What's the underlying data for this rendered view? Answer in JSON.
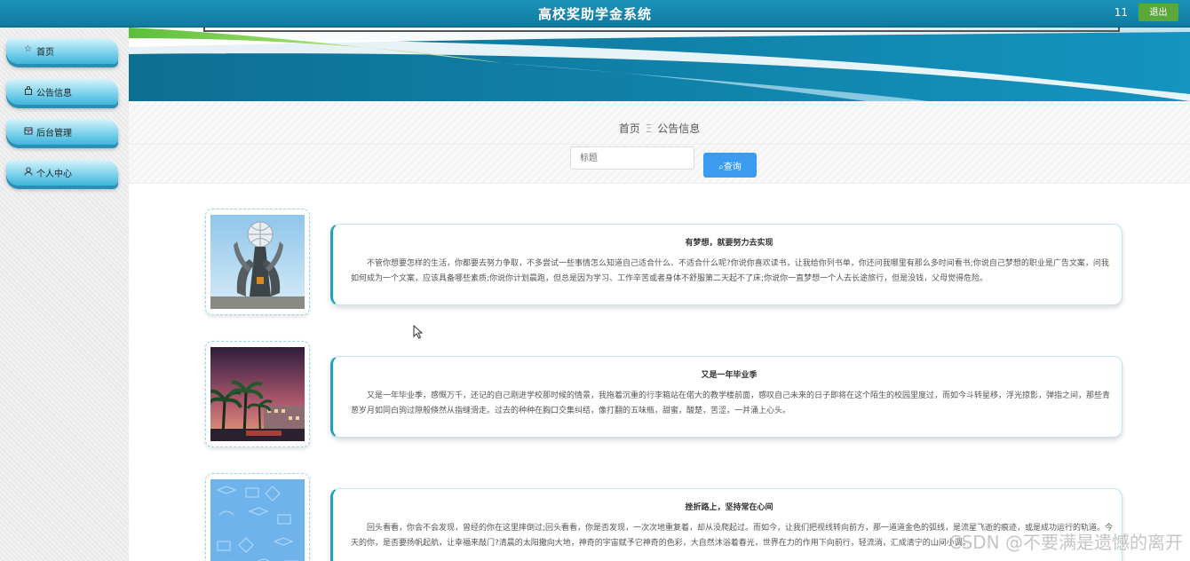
{
  "header": {
    "title": "高校奖助学金系统",
    "user": "11",
    "logout_label": "退出"
  },
  "sidebar": {
    "items": [
      {
        "label": "首页",
        "icon": "star-icon"
      },
      {
        "label": "公告信息",
        "icon": "bag-icon"
      },
      {
        "label": "后台管理",
        "icon": "box-icon"
      },
      {
        "label": "个人中心",
        "icon": "user-icon"
      }
    ]
  },
  "breadcrumb": {
    "home": "首页",
    "separator": "Ξ",
    "current": "公告信息"
  },
  "search": {
    "placeholder": "标题",
    "button_label": "查询"
  },
  "news": [
    {
      "title": "有梦想，就要努力去实现",
      "text": "不管你想要怎样的生活，你都要去努力争取，不多尝试一些事情怎么知道自己适合什么、不适合什么呢?你说你喜欢读书，让我给你列书单，你还问我哪里有那么多时间看书;你说自己梦想的职业是广告文案，问我如何成为一个文案，应该具备哪些素质;你说你计划晨跑，但总是因为学习、工作辛苦或者身体不舒服第二天起不了床;你说你一直梦想一个人去长途旅行，但是没钱，父母觉得危险。",
      "image": "statue"
    },
    {
      "title": "又是一年毕业季",
      "text": "又是一年毕业季，感慨万千，还记的自己刚进学校那时候的情景，我拖着沉重的行李箱站在偌大的教学楼前面，感叹自己未来的日子即将在这个陌生的校园里度过，而如今斗转星移，浮光掠影，弹指之间，那些青葱岁月如同白驹过隙般倏然从指缝滑走。过去的种种在胸口交集纠结，像打翻的五味瓶，甜蜜，酸楚，苦涩，一并涌上心头。",
      "image": "campus"
    },
    {
      "title": "挫折路上，坚持常在心间",
      "text": "回头看看，你会不会发现，曾经的你在这里摔倒过;回头看看，你是否发现，一次次地重复着，却从没爬起过。而如今，让我们把视线转向前方，那一道道金色的弧线，是流星飞逝的痕迹，或是成功运行的轨道。今天的你，是否要扬帆起航，让幸福来敲门?清晨的太阳撒向大地，神奇的宇宙赋予它神奇的色彩，大自然沐浴着春光，世界在力的作用下向前行，轻流淌，汇成清宁的山间小调。",
      "image": "pattern"
    }
  ],
  "watermark": "CSDN @不要满是遗憾的离开",
  "colors": {
    "header": "#1487ad",
    "accent": "#1da0c4",
    "search_button": "#3a9bf0",
    "logout": "#5aa83a"
  }
}
